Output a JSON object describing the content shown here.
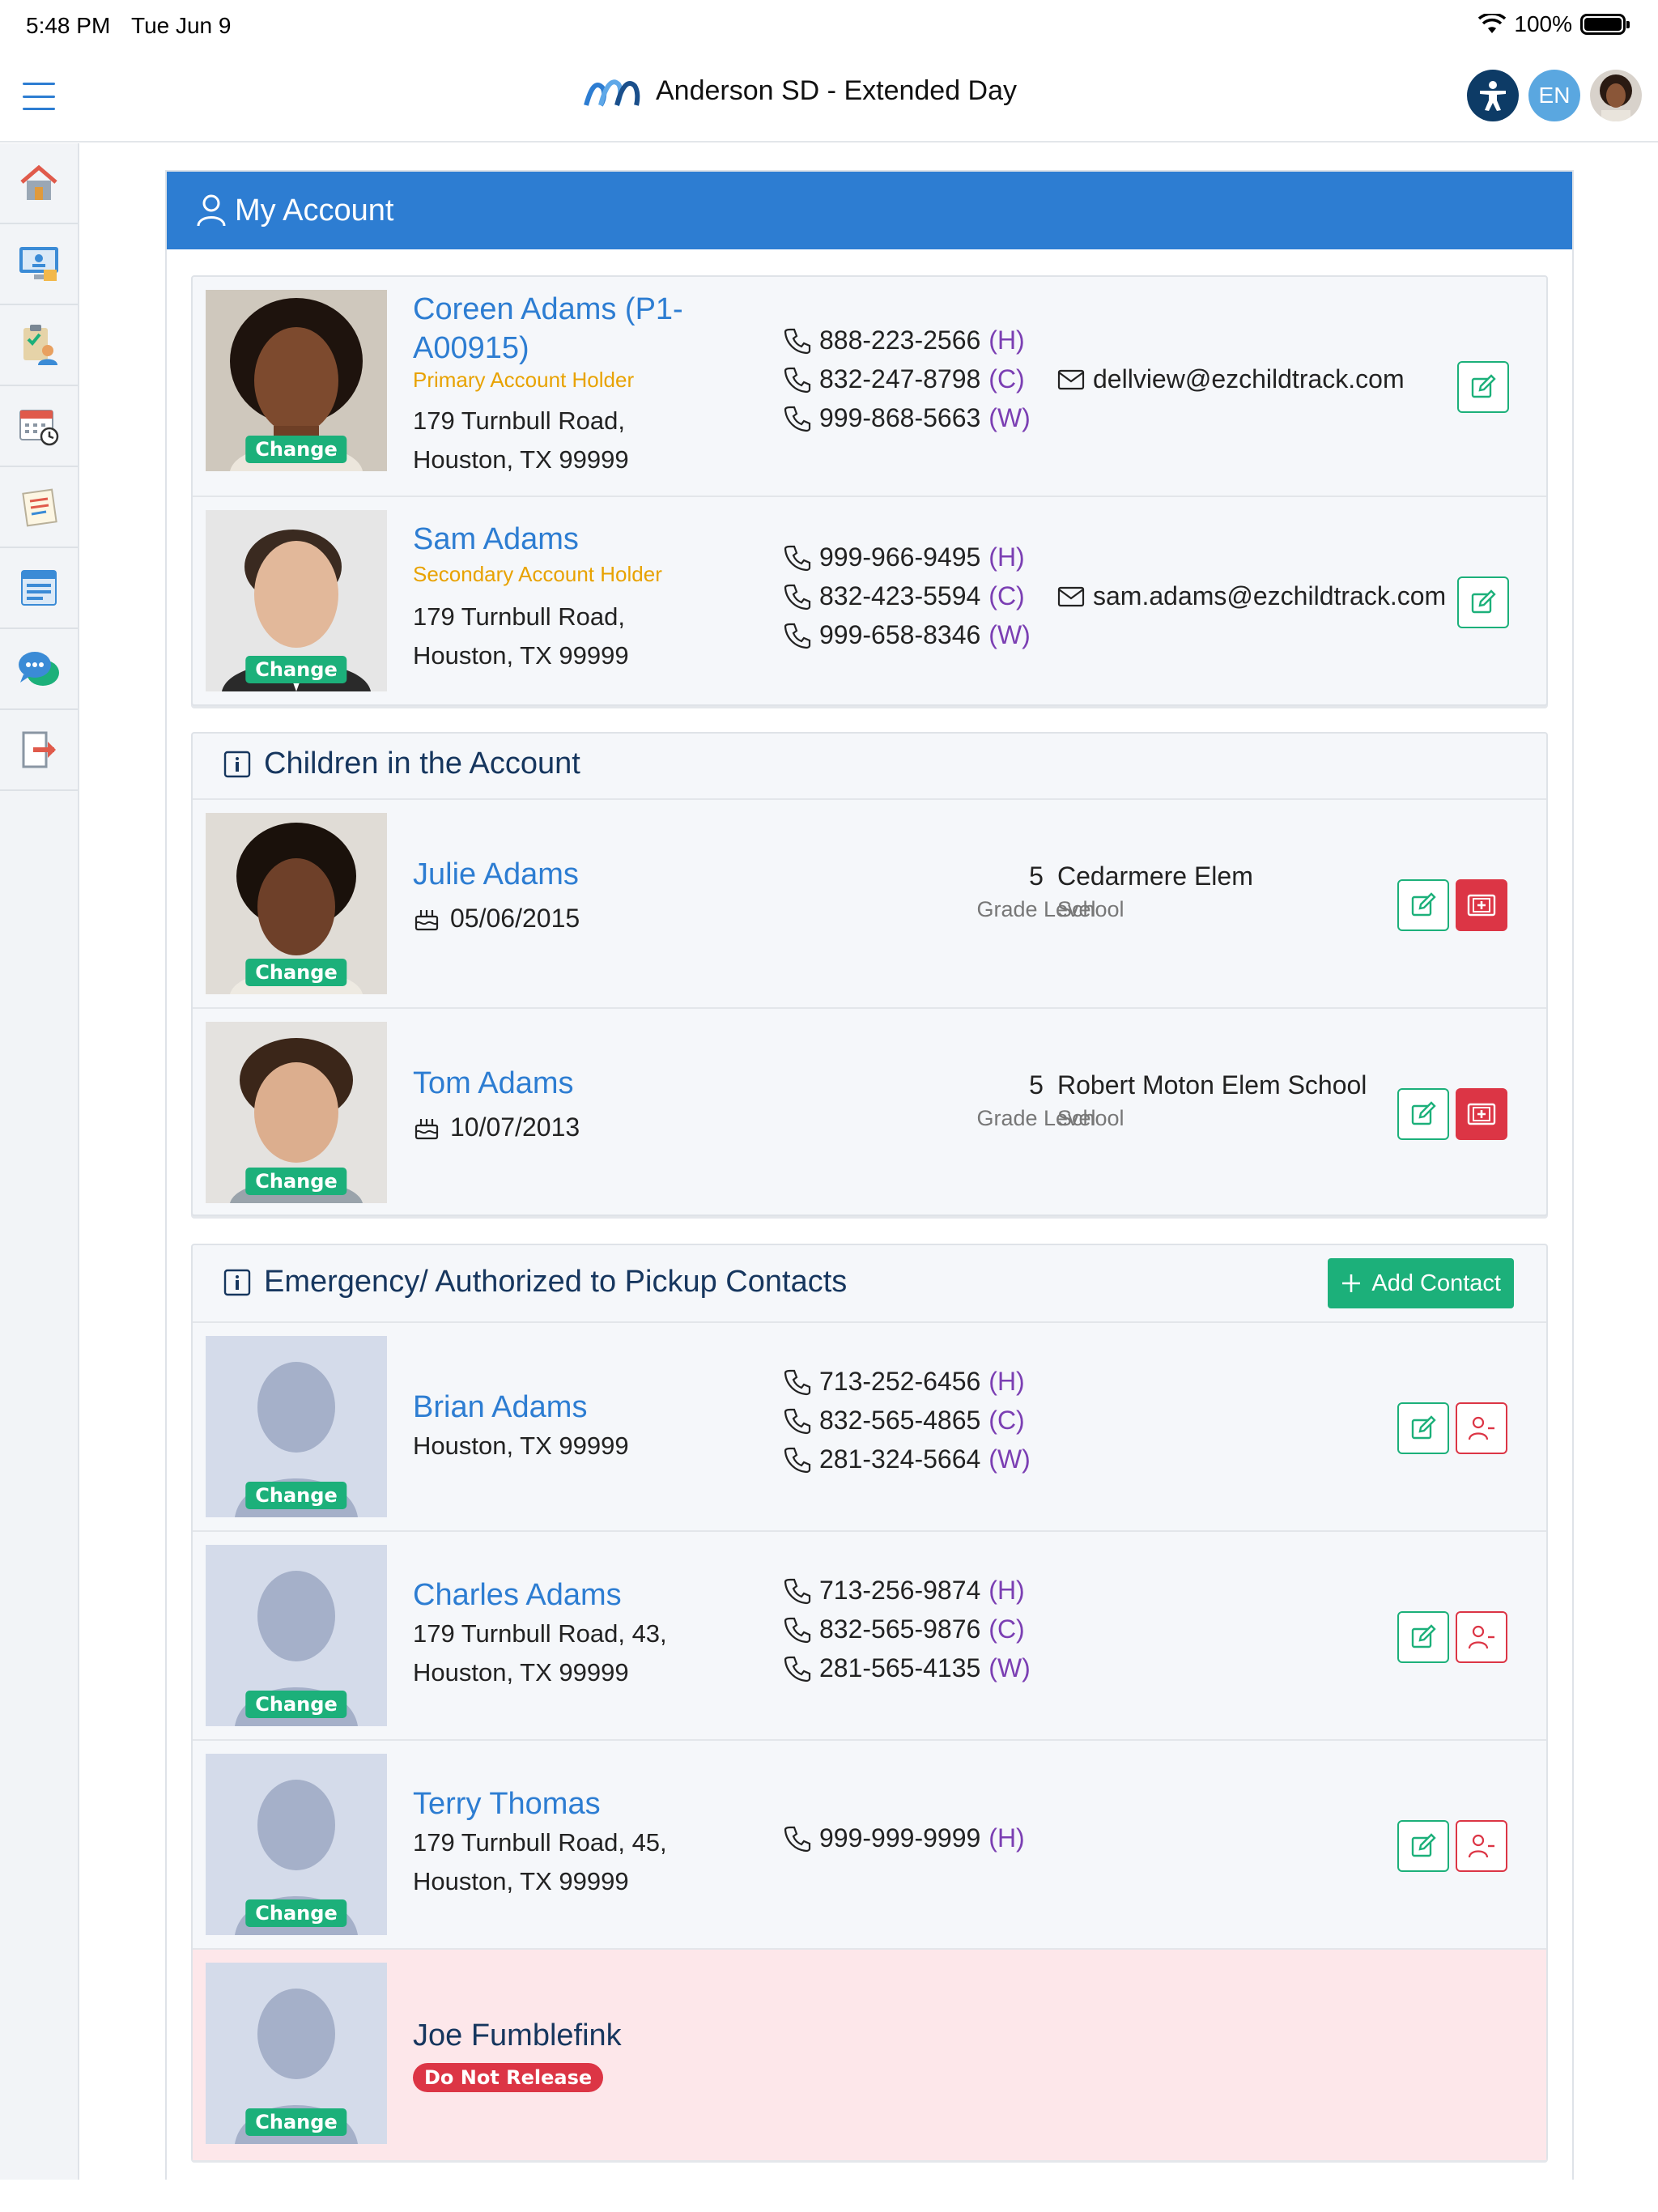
{
  "status_bar": {
    "time": "5:48 PM",
    "date": "Tue Jun 9",
    "battery": "100%"
  },
  "header": {
    "title": "Anderson SD - Extended Day",
    "lang": "EN"
  },
  "sidebar": {
    "items": [
      {
        "icon": "home-icon"
      },
      {
        "icon": "monitor-icon"
      },
      {
        "icon": "clipboard-user-icon"
      },
      {
        "icon": "calendar-clock-icon"
      },
      {
        "icon": "notes-icon"
      },
      {
        "icon": "list-form-icon"
      },
      {
        "icon": "chat-bubbles-icon"
      },
      {
        "icon": "logout-icon"
      }
    ]
  },
  "account": {
    "title": "My Account",
    "holders": [
      {
        "name": "Coreen Adams (P1-A00915)",
        "role": "Primary Account Holder",
        "addr1": "179 Turnbull Road,",
        "addr2": "Houston, TX 99999",
        "phones": [
          {
            "num": "888-223-2566",
            "kind": "(H)"
          },
          {
            "num": "832-247-8798",
            "kind": "(C)"
          },
          {
            "num": "999-868-5663",
            "kind": "(W)"
          }
        ],
        "email": "dellview@ezchildtrack.com",
        "change": "Change"
      },
      {
        "name": "Sam Adams",
        "role": "Secondary Account Holder",
        "addr1": "179 Turnbull Road,",
        "addr2": "Houston, TX 99999",
        "phones": [
          {
            "num": "999-966-9495",
            "kind": "(H)"
          },
          {
            "num": "832-423-5594",
            "kind": "(C)"
          },
          {
            "num": "999-658-8346",
            "kind": "(W)"
          }
        ],
        "email": "sam.adams@ezchildtrack.com",
        "change": "Change"
      }
    ]
  },
  "children": {
    "title": "Children in the Account",
    "items": [
      {
        "name": "Julie Adams",
        "dob": "05/06/2015",
        "grade": "5",
        "grade_label": "Grade Level",
        "school": "Cedarmere Elem",
        "school_label": "School",
        "change": "Change"
      },
      {
        "name": "Tom Adams",
        "dob": "10/07/2013",
        "grade": "5",
        "grade_label": "Grade Level",
        "school": "Robert Moton Elem School",
        "school_label": "School",
        "change": "Change"
      }
    ]
  },
  "contacts": {
    "title": "Emergency/ Authorized to Pickup Contacts",
    "add_label": "Add Contact",
    "items": [
      {
        "name": "Brian Adams",
        "addr1": "Houston, TX 99999",
        "addr2": "",
        "phones": [
          {
            "num": "713-252-6456",
            "kind": "(H)"
          },
          {
            "num": "832-565-4865",
            "kind": "(C)"
          },
          {
            "num": "281-324-5664",
            "kind": "(W)"
          }
        ],
        "change": "Change"
      },
      {
        "name": "Charles Adams",
        "addr1": "179 Turnbull Road, 43,",
        "addr2": "Houston, TX 99999",
        "phones": [
          {
            "num": "713-256-9874",
            "kind": "(H)"
          },
          {
            "num": "832-565-9876",
            "kind": "(C)"
          },
          {
            "num": "281-565-4135",
            "kind": "(W)"
          }
        ],
        "change": "Change"
      },
      {
        "name": "Terry Thomas",
        "addr1": "179 Turnbull Road, 45,",
        "addr2": "Houston, TX 99999",
        "phones": [
          {
            "num": "999-999-9999",
            "kind": "(H)"
          }
        ],
        "change": "Change"
      },
      {
        "name": "Joe Fumblefink",
        "badge": "Do Not Release",
        "change": "Change"
      }
    ]
  },
  "colors": {
    "primary": "#2d7dd2",
    "success": "#1cb07a",
    "danger": "#dc3545",
    "role": "#e8a200",
    "phone_kind": "#7b3fb3",
    "do_not_release_bg": "#fde7ea"
  }
}
